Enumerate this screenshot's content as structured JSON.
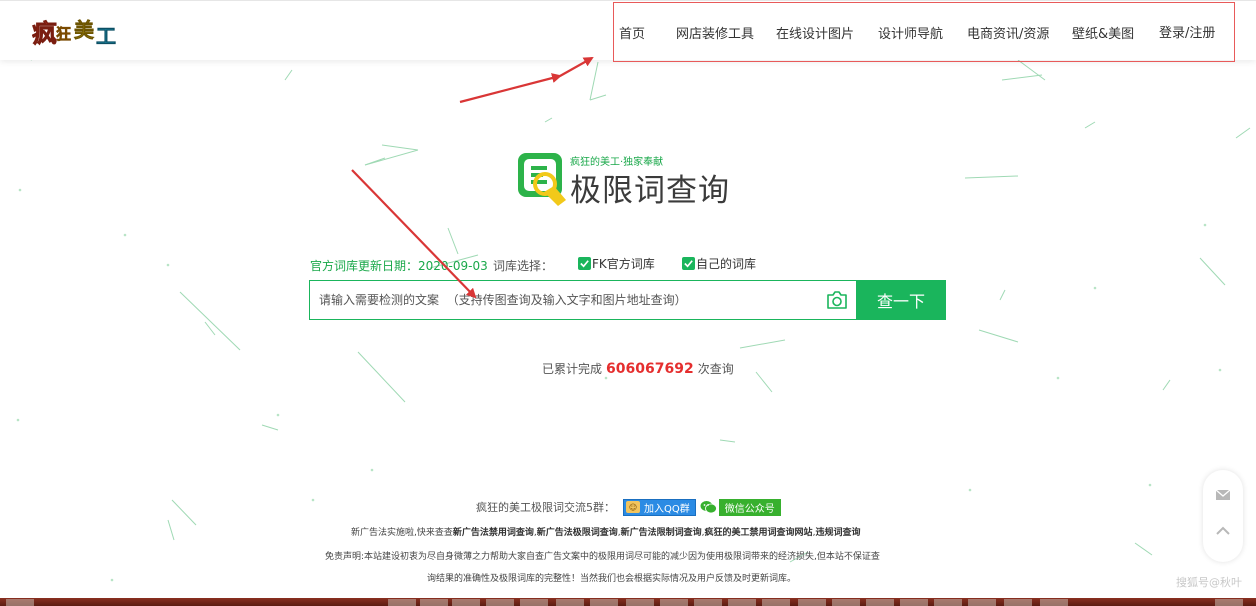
{
  "brand": {
    "logo_text": "疯狂美工",
    "slogan": "疯狂的美工·独家奉献",
    "title": "极限词查询"
  },
  "nav": {
    "items": [
      {
        "label": "首页"
      },
      {
        "label": "网店装修工具"
      },
      {
        "label": "在线设计图片"
      },
      {
        "label": "设计师导航"
      },
      {
        "label": "电商资讯/资源"
      },
      {
        "label": "壁纸&美图"
      },
      {
        "label": "登录/注册"
      }
    ]
  },
  "search": {
    "update_label": "官方词库更新日期：2020-09-03",
    "lib_label": "词库选择：",
    "options": [
      {
        "label": "FK官方词库",
        "checked": true
      },
      {
        "label": "自己的词库",
        "checked": true
      }
    ],
    "placeholder": "请输入需要检测的文案  （支持传图查询及输入文字和图片地址查询）",
    "button_label": "查一下",
    "camera_icon": "camera-icon"
  },
  "counter": {
    "prefix": "已累计完成",
    "value": "606067692",
    "suffix": "次查询"
  },
  "footer": {
    "group_text": "疯狂的美工极限词交流5群：",
    "qq_label": "加入QQ群",
    "wechat_label": "微信公众号",
    "links_parts": [
      {
        "text": "新广告法实施啦,快来查查",
        "bold": false
      },
      {
        "text": "新广告法禁用词查询",
        "bold": true
      },
      {
        "text": ",",
        "bold": false
      },
      {
        "text": "新广告法极限词查询",
        "bold": true
      },
      {
        "text": ",",
        "bold": false
      },
      {
        "text": "新广告法限制词查询",
        "bold": true
      },
      {
        "text": ",",
        "bold": false
      },
      {
        "text": "疯狂的美工禁用词查询网站",
        "bold": true
      },
      {
        "text": ",",
        "bold": false
      },
      {
        "text": "违规词查询",
        "bold": true
      }
    ],
    "disclaimer_line1": "免责声明:本站建设初衷为尽自身微薄之力帮助大家自查广告文案中的极限用词尽可能的减少因为使用极限词带来的经济损失,但本站不保证查",
    "disclaimer_line2": "询结果的准确性及极限词库的完整性！当然我们也会根据实际情况及用户反馈及时更新词库。"
  },
  "float_tools": [
    "mail-icon",
    "back-to-top-icon"
  ],
  "watermark": "搜狐号@秋叶",
  "colors": {
    "accent": "#1ab55c",
    "accent_text": "#1aa84a",
    "counter": "#e52e2e",
    "annotation": "#e85a5a",
    "arrow": "#d93636"
  }
}
